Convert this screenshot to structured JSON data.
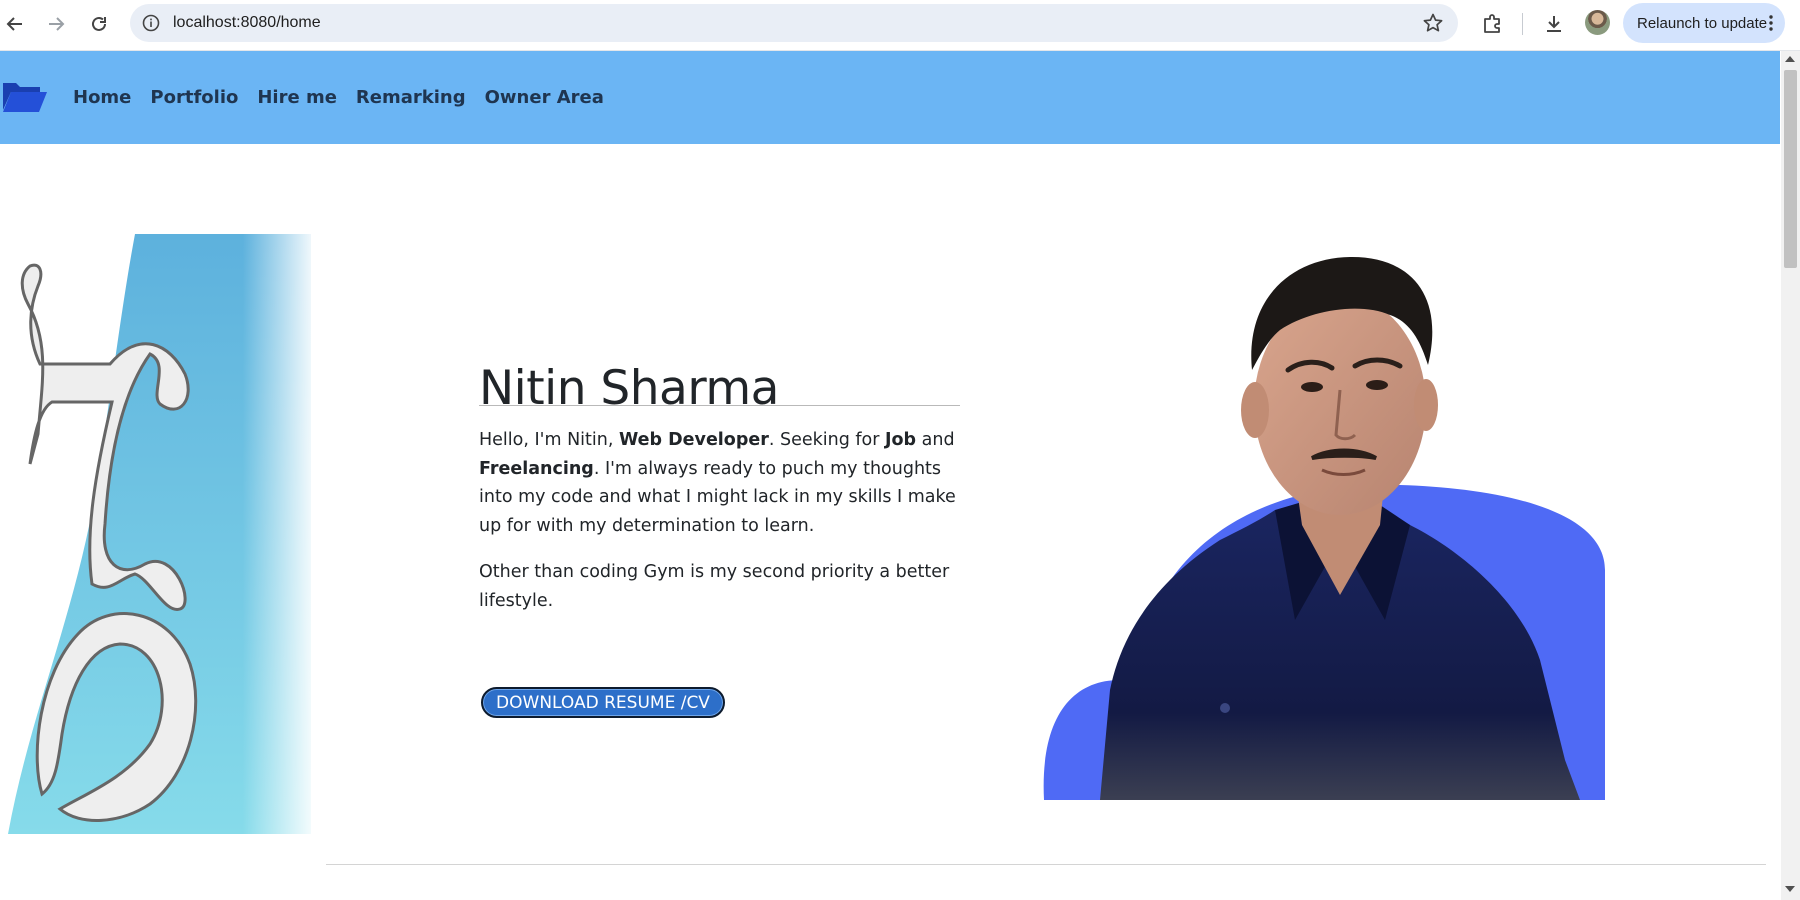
{
  "browser": {
    "url": "localhost:8080/home",
    "relaunch_label": "Relaunch to update"
  },
  "navbar": {
    "links": [
      {
        "label": "Home"
      },
      {
        "label": "Portfolio"
      },
      {
        "label": "Hire me"
      },
      {
        "label": "Remarking"
      },
      {
        "label": "Owner Area"
      }
    ],
    "background_color": "#6bb5f4"
  },
  "hero": {
    "name": "Nitin Sharma",
    "bio_parts": [
      "Hello, I'm Nitin, ",
      "Web Developer",
      ". Seeking for ",
      "Job",
      " and ",
      "Freelancing",
      ". I'm always ready to puch my thoughts into my code and what I might lack in my skills I make up for with my determination to learn."
    ],
    "bio_second": "Other than coding Gym is my second priority a better lifestyle.",
    "download_label": "DOWNLOAD RESUME /CV",
    "logo_letters": "DH",
    "accent_blob_color": "#4f6af5",
    "button_color": "#2d6fc9"
  }
}
